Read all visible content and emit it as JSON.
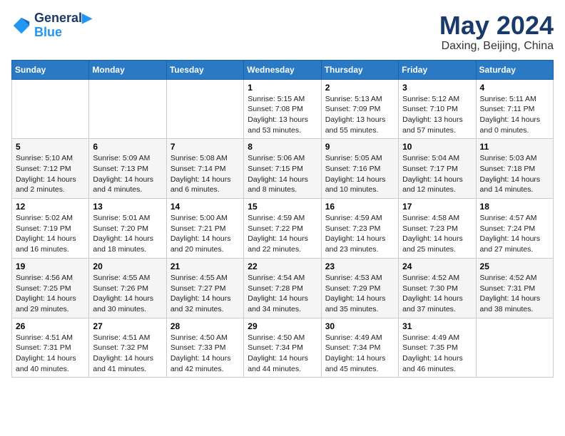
{
  "header": {
    "logo_line1": "General",
    "logo_line2": "Blue",
    "month": "May 2024",
    "location": "Daxing, Beijing, China"
  },
  "weekdays": [
    "Sunday",
    "Monday",
    "Tuesday",
    "Wednesday",
    "Thursday",
    "Friday",
    "Saturday"
  ],
  "weeks": [
    [
      {
        "day": "",
        "info": ""
      },
      {
        "day": "",
        "info": ""
      },
      {
        "day": "",
        "info": ""
      },
      {
        "day": "1",
        "info": "Sunrise: 5:15 AM\nSunset: 7:08 PM\nDaylight: 13 hours and 53 minutes."
      },
      {
        "day": "2",
        "info": "Sunrise: 5:13 AM\nSunset: 7:09 PM\nDaylight: 13 hours and 55 minutes."
      },
      {
        "day": "3",
        "info": "Sunrise: 5:12 AM\nSunset: 7:10 PM\nDaylight: 13 hours and 57 minutes."
      },
      {
        "day": "4",
        "info": "Sunrise: 5:11 AM\nSunset: 7:11 PM\nDaylight: 14 hours and 0 minutes."
      }
    ],
    [
      {
        "day": "5",
        "info": "Sunrise: 5:10 AM\nSunset: 7:12 PM\nDaylight: 14 hours and 2 minutes."
      },
      {
        "day": "6",
        "info": "Sunrise: 5:09 AM\nSunset: 7:13 PM\nDaylight: 14 hours and 4 minutes."
      },
      {
        "day": "7",
        "info": "Sunrise: 5:08 AM\nSunset: 7:14 PM\nDaylight: 14 hours and 6 minutes."
      },
      {
        "day": "8",
        "info": "Sunrise: 5:06 AM\nSunset: 7:15 PM\nDaylight: 14 hours and 8 minutes."
      },
      {
        "day": "9",
        "info": "Sunrise: 5:05 AM\nSunset: 7:16 PM\nDaylight: 14 hours and 10 minutes."
      },
      {
        "day": "10",
        "info": "Sunrise: 5:04 AM\nSunset: 7:17 PM\nDaylight: 14 hours and 12 minutes."
      },
      {
        "day": "11",
        "info": "Sunrise: 5:03 AM\nSunset: 7:18 PM\nDaylight: 14 hours and 14 minutes."
      }
    ],
    [
      {
        "day": "12",
        "info": "Sunrise: 5:02 AM\nSunset: 7:19 PM\nDaylight: 14 hours and 16 minutes."
      },
      {
        "day": "13",
        "info": "Sunrise: 5:01 AM\nSunset: 7:20 PM\nDaylight: 14 hours and 18 minutes."
      },
      {
        "day": "14",
        "info": "Sunrise: 5:00 AM\nSunset: 7:21 PM\nDaylight: 14 hours and 20 minutes."
      },
      {
        "day": "15",
        "info": "Sunrise: 4:59 AM\nSunset: 7:22 PM\nDaylight: 14 hours and 22 minutes."
      },
      {
        "day": "16",
        "info": "Sunrise: 4:59 AM\nSunset: 7:23 PM\nDaylight: 14 hours and 23 minutes."
      },
      {
        "day": "17",
        "info": "Sunrise: 4:58 AM\nSunset: 7:23 PM\nDaylight: 14 hours and 25 minutes."
      },
      {
        "day": "18",
        "info": "Sunrise: 4:57 AM\nSunset: 7:24 PM\nDaylight: 14 hours and 27 minutes."
      }
    ],
    [
      {
        "day": "19",
        "info": "Sunrise: 4:56 AM\nSunset: 7:25 PM\nDaylight: 14 hours and 29 minutes."
      },
      {
        "day": "20",
        "info": "Sunrise: 4:55 AM\nSunset: 7:26 PM\nDaylight: 14 hours and 30 minutes."
      },
      {
        "day": "21",
        "info": "Sunrise: 4:55 AM\nSunset: 7:27 PM\nDaylight: 14 hours and 32 minutes."
      },
      {
        "day": "22",
        "info": "Sunrise: 4:54 AM\nSunset: 7:28 PM\nDaylight: 14 hours and 34 minutes."
      },
      {
        "day": "23",
        "info": "Sunrise: 4:53 AM\nSunset: 7:29 PM\nDaylight: 14 hours and 35 minutes."
      },
      {
        "day": "24",
        "info": "Sunrise: 4:52 AM\nSunset: 7:30 PM\nDaylight: 14 hours and 37 minutes."
      },
      {
        "day": "25",
        "info": "Sunrise: 4:52 AM\nSunset: 7:31 PM\nDaylight: 14 hours and 38 minutes."
      }
    ],
    [
      {
        "day": "26",
        "info": "Sunrise: 4:51 AM\nSunset: 7:31 PM\nDaylight: 14 hours and 40 minutes."
      },
      {
        "day": "27",
        "info": "Sunrise: 4:51 AM\nSunset: 7:32 PM\nDaylight: 14 hours and 41 minutes."
      },
      {
        "day": "28",
        "info": "Sunrise: 4:50 AM\nSunset: 7:33 PM\nDaylight: 14 hours and 42 minutes."
      },
      {
        "day": "29",
        "info": "Sunrise: 4:50 AM\nSunset: 7:34 PM\nDaylight: 14 hours and 44 minutes."
      },
      {
        "day": "30",
        "info": "Sunrise: 4:49 AM\nSunset: 7:34 PM\nDaylight: 14 hours and 45 minutes."
      },
      {
        "day": "31",
        "info": "Sunrise: 4:49 AM\nSunset: 7:35 PM\nDaylight: 14 hours and 46 minutes."
      },
      {
        "day": "",
        "info": ""
      }
    ]
  ]
}
